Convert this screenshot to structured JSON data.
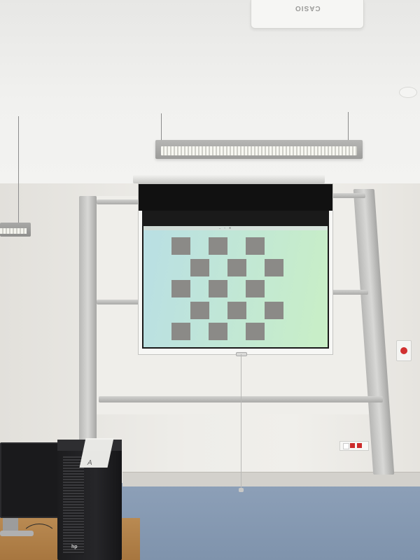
{
  "scene": {
    "projector_brand": "CASIO",
    "pc_brand": "hp",
    "paper_mark": "A"
  },
  "projection": {
    "window_title": "",
    "pattern": "checkerboard",
    "pattern_rows": 5,
    "pattern_columns": 6,
    "dark_square_color": "#8b8a87",
    "background_colors": [
      "#b9dfe4",
      "#c9efc6"
    ]
  },
  "colors": {
    "wall": "#eeede9",
    "floor": "#8da0b8",
    "screen_black_border": "#111111",
    "outlet_red": "#cc2b2b"
  }
}
